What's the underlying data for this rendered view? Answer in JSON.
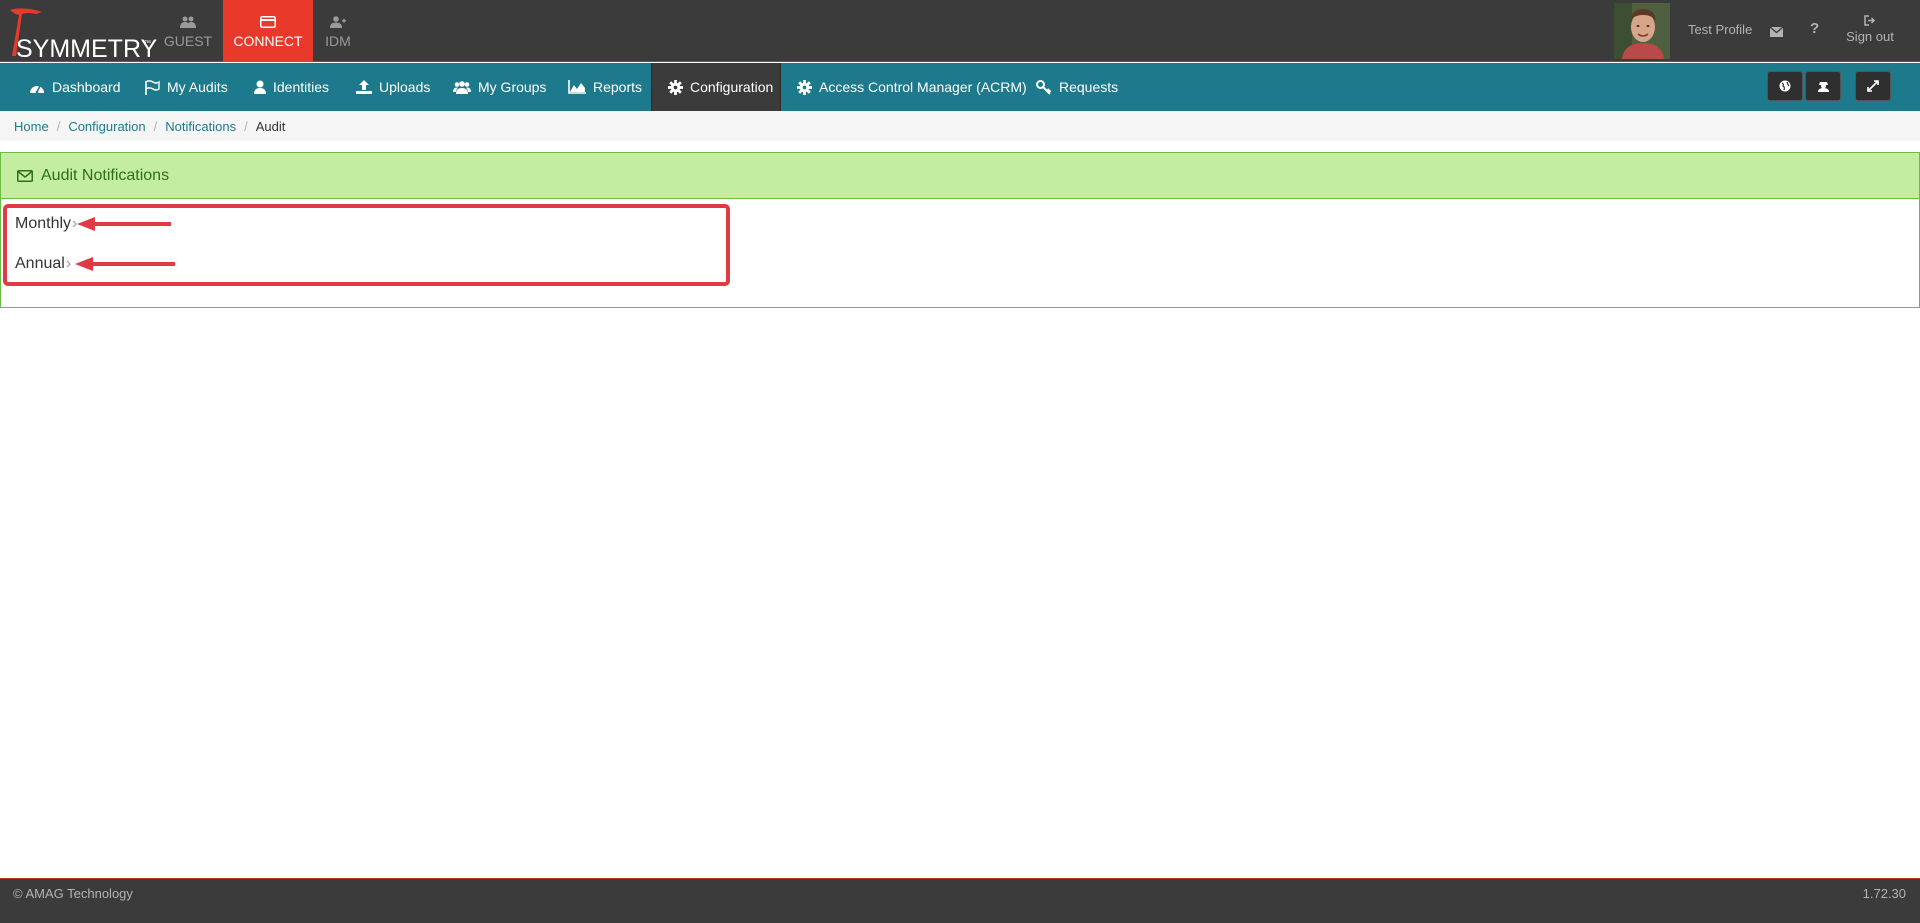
{
  "brand": {
    "name": "SYMMETRY",
    "tm": "™"
  },
  "app_tabs": [
    {
      "label": "GUEST",
      "icon": "users-icon"
    },
    {
      "label": "CONNECT",
      "icon": "credit-card-icon"
    },
    {
      "label": "IDM",
      "icon": "user-plus-icon"
    }
  ],
  "header": {
    "profile_name": "Test Profile",
    "help": "?",
    "signout_label": "Sign out"
  },
  "nav": [
    {
      "label": "Dashboard",
      "icon": "dashboard-icon"
    },
    {
      "label": "My Audits",
      "icon": "flag-icon"
    },
    {
      "label": "Identities",
      "icon": "user-icon"
    },
    {
      "label": "Uploads",
      "icon": "upload-icon"
    },
    {
      "label": "My Groups",
      "icon": "group-icon"
    },
    {
      "label": "Reports",
      "icon": "area-chart-icon"
    },
    {
      "label": "Configuration",
      "icon": "gear-icon"
    },
    {
      "label": "Access Control Manager (ACRM)",
      "icon": "gear-icon"
    },
    {
      "label": "Requests",
      "icon": "key-icon"
    }
  ],
  "breadcrumb": {
    "items": [
      "Home",
      "Configuration",
      "Notifications"
    ],
    "current": "Audit"
  },
  "panel": {
    "title": "Audit Notifications",
    "items": [
      {
        "label": "Monthly",
        "chevron": "›"
      },
      {
        "label": "Annual",
        "chevron": "›"
      }
    ]
  },
  "footer": {
    "copyright": "© AMAG Technology",
    "version": "1.72.30"
  },
  "colors": {
    "topbar": "#3b3b3b",
    "connect_active": "#e8392b",
    "navbar": "#1d7a8c",
    "panel_header": "#c3eda1",
    "annotation": "#e03a44"
  }
}
